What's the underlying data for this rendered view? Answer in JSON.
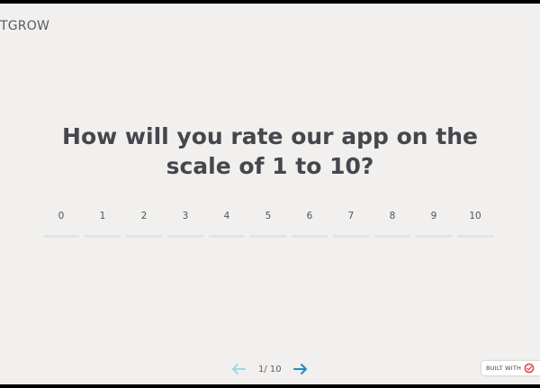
{
  "brand": {
    "logo_text": "TGROW"
  },
  "question": {
    "line1": "How will you rate our app on the",
    "line2": "scale of 1 to 10?"
  },
  "scale": {
    "options": [
      "0",
      "1",
      "2",
      "3",
      "4",
      "5",
      "6",
      "7",
      "8",
      "9",
      "10"
    ]
  },
  "pager": {
    "count": "1/ 10",
    "prev_icon": "arrow-left-icon",
    "next_icon": "arrow-right-icon"
  },
  "badge": {
    "label": "BUILT WITH",
    "icon": "outgrow-logo-icon"
  },
  "colors": {
    "background": "#f1f0ee",
    "heading": "#45474d",
    "bar": "#e1e4e7",
    "prev_arrow": "#9fd6ea",
    "next_arrow": "#1a8fc0",
    "badge_logo": "#e8484d"
  }
}
